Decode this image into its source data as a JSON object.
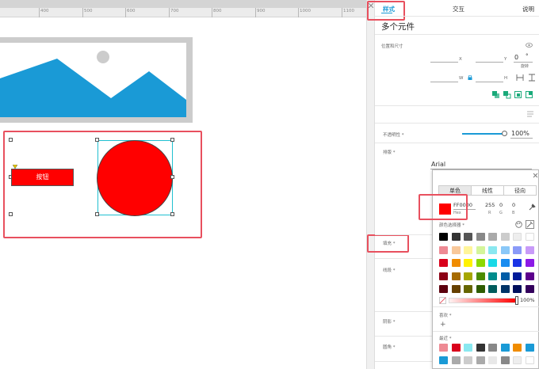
{
  "ruler": {
    "labels": [
      "400",
      "500",
      "600",
      "700",
      "800",
      "900",
      "1000",
      "1100"
    ]
  },
  "canvas": {
    "button_label": "按钮"
  },
  "panel": {
    "tabs": [
      "样式",
      "交互",
      "说明"
    ],
    "title": "多个元件",
    "position_size_label": "位置和尺寸",
    "x_label": "X",
    "y_label": "Y",
    "w_label": "W",
    "h_label": "H",
    "rotation_value": "0",
    "rotation_unit": "°",
    "rotation_label": "旋转",
    "opacity_label": "不透明性 *",
    "opacity_value": "100%",
    "opacity_fraction": 1.0,
    "typography_label": "排版 *",
    "font_value": "Arial",
    "fill_label": "填充 *",
    "border_label": "线段 *",
    "shadow_label": "阴影 *",
    "corner_label": "圆角 *"
  },
  "color_picker": {
    "tabs": [
      "单色",
      "线性",
      "径向"
    ],
    "hex_value": "FF0000",
    "hex_label": "Hex",
    "r_value": "255",
    "g_value": "0",
    "b_value": "0",
    "r_label": "R",
    "g_label": "G",
    "b_label": "B",
    "picker_label": "颜色选择器 *",
    "alpha_value": "100%",
    "favorites_label": "喜欢 *",
    "add_symbol": "+",
    "recent_label": "最近 *",
    "current_color": "#ff0000"
  },
  "colors": {
    "accent": "#1a9ad6",
    "highlight": "#e8505e",
    "selection_red": "#ff0000",
    "image_blue": "#1a9ad6",
    "teal_icon": "#1aaa7a"
  },
  "palette": [
    [
      "#000000",
      "#333333",
      "#555555",
      "#888888",
      "#aaaaaa",
      "#cccccc",
      "#eeeeee",
      "#ffffff"
    ],
    [
      "#ee8a94",
      "#f8c89a",
      "#fff59a",
      "#d4f59a",
      "#8ae8f0",
      "#8ac8f8",
      "#8a9af8",
      "#c89af8"
    ],
    [
      "#d9001b",
      "#f08c00",
      "#fff200",
      "#8cd900",
      "#1ad9e6",
      "#1a8cf0",
      "#1a33e6",
      "#8c1ae6"
    ],
    [
      "#8c0014",
      "#a66b00",
      "#a6a600",
      "#4c8c00",
      "#008c8c",
      "#005ca6",
      "#001a99",
      "#5c008c"
    ],
    [
      "#5c000d",
      "#664000",
      "#666600",
      "#2e5c00",
      "#005c5c",
      "#003366",
      "#000f5c",
      "#33005c"
    ]
  ],
  "recent_colors": [
    [
      "#ee8a94",
      "#d9001b",
      "#8ae8f0",
      "#333333",
      "#888888",
      "#1a9ad6",
      "#f08c00",
      "#1a9ad6"
    ],
    [
      "#1a9ad6",
      "#aaaaaa",
      "#cccccc",
      "#aaaaaa",
      "#e8e8e8",
      "#888888",
      "#eeeeee",
      "#ffffff"
    ]
  ]
}
